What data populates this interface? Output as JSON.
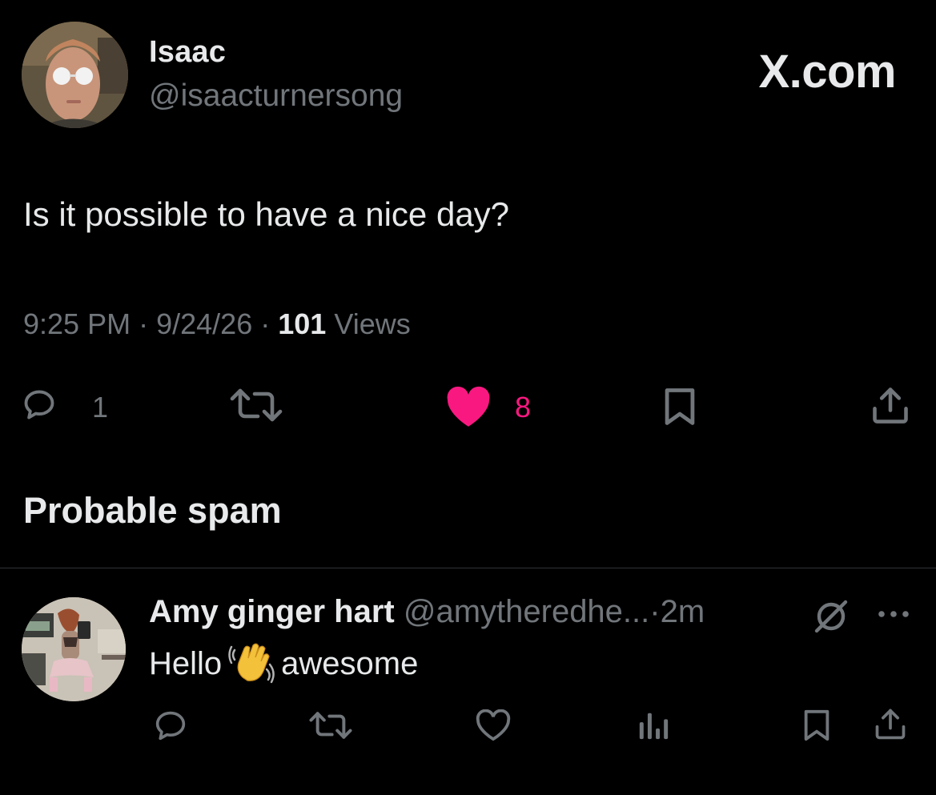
{
  "tweet": {
    "author_name": "Isaac",
    "author_handle": "@isaacturnersong",
    "brand": "X.com",
    "text": "Is it possible to have a nice day?",
    "time": "9:25 PM",
    "separator": "·",
    "date": "9/24/26",
    "views_count": "101",
    "views_label": "Views",
    "actions": {
      "reply_icon": "reply-icon",
      "reply_count": "1",
      "retweet_icon": "retweet-icon",
      "like_icon": "heart-filled-icon",
      "like_count": "8",
      "like_color": "#f91880",
      "bookmark_icon": "bookmark-icon",
      "share_icon": "share-icon"
    }
  },
  "section_title": "Probable spam",
  "reply": {
    "author_name": "Amy ginger hart",
    "author_handle": "@amytheredhe...",
    "separator": "·",
    "time": "2m",
    "text_before": "Hello",
    "emoji": "waving-hand-emoji",
    "text_after": "awesome",
    "actions": [
      "reply-icon",
      "retweet-icon",
      "heart-icon",
      "views-icon",
      "bookmark-icon",
      "share-icon"
    ]
  },
  "colors": {
    "background": "#000000",
    "text": "#e7e9ea",
    "muted": "#71767b",
    "like": "#f91880",
    "divider": "#2f3336"
  }
}
